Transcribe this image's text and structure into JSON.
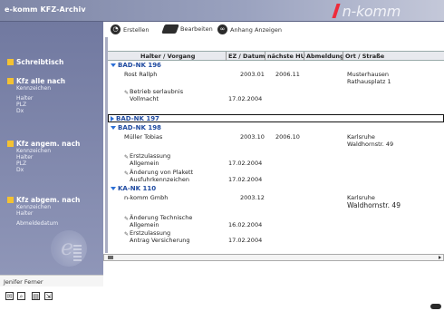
{
  "app_title": "e-komm KFZ-Archiv",
  "brand": "n-komm",
  "toolbar": {
    "create_label": "Erstellen",
    "edit_label": "Bearbeiten",
    "attachment_label": "Anhang Anzeigen"
  },
  "sidebar": {
    "groups": [
      {
        "title": "Schreibtisch",
        "items": []
      },
      {
        "title": "Kfz alle nach",
        "items": [
          "Kennzeichen",
          "Halter",
          "PLZ",
          "Dx"
        ]
      },
      {
        "title": "Kfz angem. nach",
        "items": [
          "Kennzeichen",
          "Halter",
          "PLZ",
          "Dx"
        ]
      },
      {
        "title": "Kfz abgem. nach",
        "items": [
          "Kennzeichen",
          "Halter",
          "Abmeldedatum"
        ]
      }
    ]
  },
  "user_name": "Jenifer Ferner",
  "columns": [
    "Halter / Vorgang",
    "EZ / Datum",
    "nächste HU",
    "Abmeldung",
    "Ort / Straße"
  ],
  "groups": [
    {
      "plate": "BAD-NK 196",
      "expanded": true,
      "holder": {
        "name": "Rost Rallph",
        "ez": "2003.01",
        "hu": "2006.11",
        "place": "Musterhausen",
        "street": "Rathausplatz 1"
      },
      "actions": [
        {
          "line1": "Betrieb serlaubnis",
          "line2": "Vollmacht",
          "date": "17.02.2004"
        }
      ]
    },
    {
      "plate": "BAD-NK 197",
      "expanded": false,
      "selected": true
    },
    {
      "plate": "BAD-NK 198",
      "expanded": true,
      "holder": {
        "name": "Müller Tobias",
        "ez": "2003.10",
        "hu": "2006.10",
        "place": "Karlsruhe",
        "street": "Waldhornstr. 49"
      },
      "actions": [
        {
          "line1": "Erstzulassung",
          "line2": "Allgemein",
          "date": "17.02.2004"
        },
        {
          "line1": "Änderung von Plakett",
          "line2": "Ausfuhrkennzeichen",
          "date": "17.02.2004"
        }
      ]
    },
    {
      "plate": "KA-NK 110",
      "expanded": true,
      "holder": {
        "name": "n-komm Gmbh",
        "ez": "2003.12",
        "hu": "",
        "place": "Karlsruhe",
        "street": "Waldhornstr. 49"
      },
      "actions": [
        {
          "line1": "Änderung Technische",
          "line2": "Allgemein",
          "date": "16.02.2004"
        },
        {
          "line1": "Erstzulassung",
          "line2": "Antrag Versicherung",
          "date": "17.02.2004"
        }
      ]
    }
  ],
  "colors": {
    "sidebar": "#7a82a7",
    "accent_yellow": "#f4c232",
    "brand_red": "#ee2b3b",
    "group_blue": "#1f4aa0"
  }
}
